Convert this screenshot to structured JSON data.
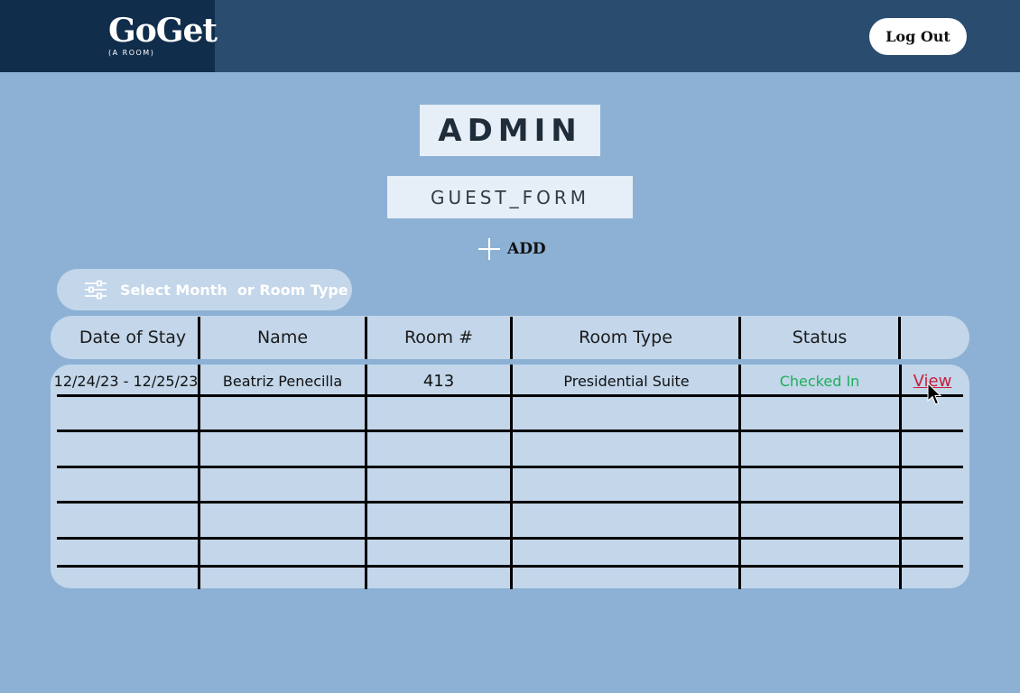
{
  "header": {
    "logo_title": "GoGet",
    "logo_subtitle": "(A ROOM)",
    "logout_label": "Log Out"
  },
  "page": {
    "admin_title": "ADMIN",
    "form_title": "GUEST_FORM",
    "add_label": "ADD"
  },
  "filter": {
    "label": "Select Month  or Room Type",
    "icon": "sliders-icon"
  },
  "table": {
    "columns": [
      "Date of Stay",
      "Name",
      "Room #",
      "Room Type",
      "Status",
      ""
    ],
    "rows": [
      {
        "date": "12/24/23 - 12/25/23",
        "name": "Beatriz Penecilla",
        "room": "413",
        "room_type": "Presidential Suite",
        "status": "Checked In",
        "action": "View"
      }
    ]
  },
  "colors": {
    "background": "#8cb1d4",
    "header": "#2a4c6e",
    "logo_block": "#102d4b",
    "table_fill": "#c3d6ea",
    "status_checked_in": "#1fae5b",
    "view_link": "#c81e3a"
  }
}
